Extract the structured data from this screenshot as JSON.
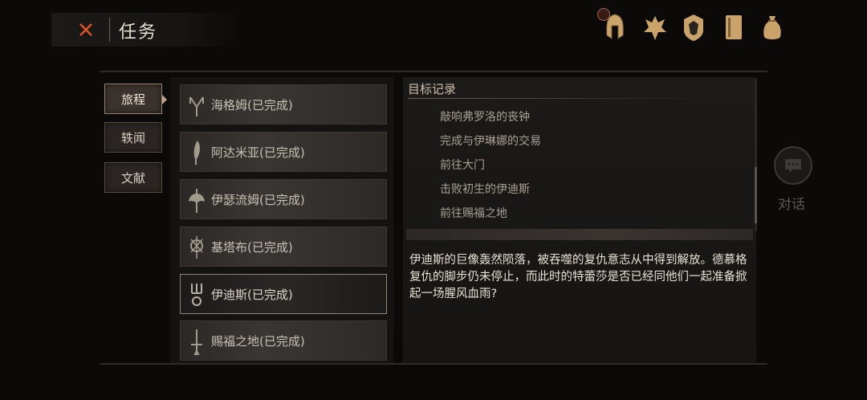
{
  "header": {
    "title": "任务"
  },
  "tabs": [
    {
      "label": "旅程"
    },
    {
      "label": "轶闻"
    },
    {
      "label": "文献"
    }
  ],
  "quests": [
    {
      "label": "海格姆(已完成)",
      "icon": "rune-m-icon"
    },
    {
      "label": "阿达米亚(已完成)",
      "icon": "blade-icon"
    },
    {
      "label": "伊瑟流姆(已完成)",
      "icon": "axe-icon"
    },
    {
      "label": "基塔布(已完成)",
      "icon": "tribal-sigil-icon"
    },
    {
      "label": "伊迪斯(已完成)",
      "icon": "trident-icon"
    },
    {
      "label": "赐福之地(已完成)",
      "icon": "sword-icon"
    }
  ],
  "objectives": {
    "title": "目标记录",
    "items": [
      "敲响弗罗洛的丧钟",
      "完成与伊琳娜的交易",
      "前往大门",
      "击败初生的伊迪斯",
      "前往赐福之地"
    ]
  },
  "description": "伊迪斯的巨像轰然陨落，被吞噬的复仇意志从中得到解放。德慕格复仇的脚步仍未停止，而此时的特蕾莎是否已经同他们一起准备掀起一场腥风血雨?",
  "chat": {
    "label": "对话"
  },
  "colors": {
    "accent": "#c9a36a",
    "close": "#e0532a"
  }
}
